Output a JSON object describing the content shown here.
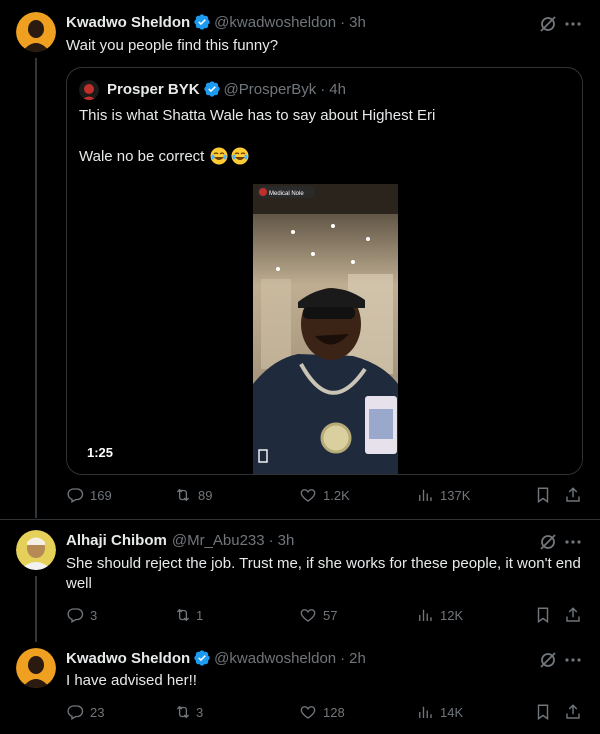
{
  "thread": {
    "tweet1": {
      "name": "Kwadwo Sheldon",
      "handle": "@kwadwosheldon",
      "time": "3h",
      "text": "Wait you people find this funny?",
      "quote": {
        "name": "Prosper BYK",
        "handle": "@ProsperByk",
        "time": "4h",
        "line1": "This is what Shatta Wale has to say about Highest Eri",
        "line2": "Wale no be correct",
        "video": {
          "duration": "1:25",
          "watermark": "Medical Nole"
        }
      },
      "stats": {
        "replies": "169",
        "reposts": "89",
        "likes": "1.2K",
        "views": "137K"
      }
    },
    "tweet2": {
      "name": "Alhaji Chibom",
      "handle": "@Mr_Abu233",
      "time": "3h",
      "text": "She should reject the job. Trust me, if she works for these people, it won't end well",
      "stats": {
        "replies": "3",
        "reposts": "1",
        "likes": "57",
        "views": "12K"
      }
    },
    "tweet3": {
      "name": "Kwadwo Sheldon",
      "handle": "@kwadwosheldon",
      "time": "2h",
      "text": "I have advised her!!",
      "stats": {
        "replies": "23",
        "reposts": "3",
        "likes": "128",
        "views": "14K"
      }
    }
  },
  "colors": {
    "background": "#000000",
    "text": "#e7e9ea",
    "muted": "#71767b",
    "verified": "#1d9bf0",
    "border": "#2f3336"
  },
  "icons": [
    "verified-badge-icon",
    "grok-icon",
    "more-icon",
    "reply-icon",
    "repost-icon",
    "like-icon",
    "views-icon",
    "bookmark-icon",
    "share-icon"
  ]
}
